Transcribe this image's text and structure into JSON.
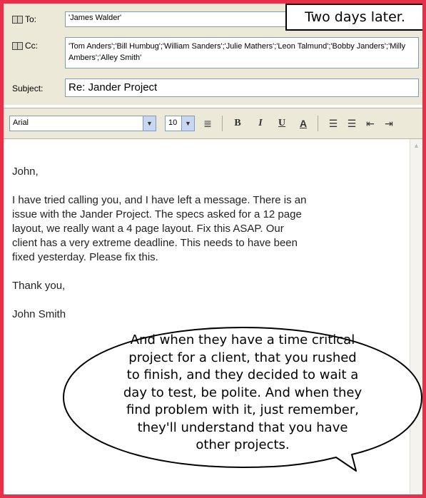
{
  "header": {
    "to_label": "To:",
    "to_value": "'James Walder'",
    "cc_label": "Cc:",
    "cc_value": "'Tom Anders';'Bill Humbug';'William Sanders';'Julie Mathers';'Leon Talmund';'Bobby Janders';'Milly Ambers';'Alley Smith'",
    "subject_label": "Subject:",
    "subject_value": "Re: Jander Project"
  },
  "caption": "Two days later.",
  "toolbar": {
    "font": "Arial",
    "size": "10",
    "bold": "B",
    "italic": "I",
    "underline": "U",
    "font_color": "A"
  },
  "message": {
    "greeting": "John,",
    "paragraph": [
      "I have tried calling you, and I have left a message.  There is an",
      "issue with the Jander Project.  The specs asked for a 12 page",
      "layout, we really want a 4 page layout.  Fix this ASAP.  Our",
      "client has a very extreme deadline.  This needs to have been",
      "fixed yesterday.  Please fix this."
    ],
    "closing": "Thank you,",
    "signature": "John Smith"
  },
  "bubble": {
    "lines": [
      "And when they have a time critical",
      "project for a client, that you rushed",
      "to finish, and they decided to wait a",
      "day to test, be polite.  And when they",
      "find  problem with it, just remember,",
      "they'll understand that you have",
      "other projects."
    ]
  },
  "colors": {
    "frame_border": "#e8304a",
    "chrome": "#ece9d8",
    "field_border": "#7f9db9"
  }
}
